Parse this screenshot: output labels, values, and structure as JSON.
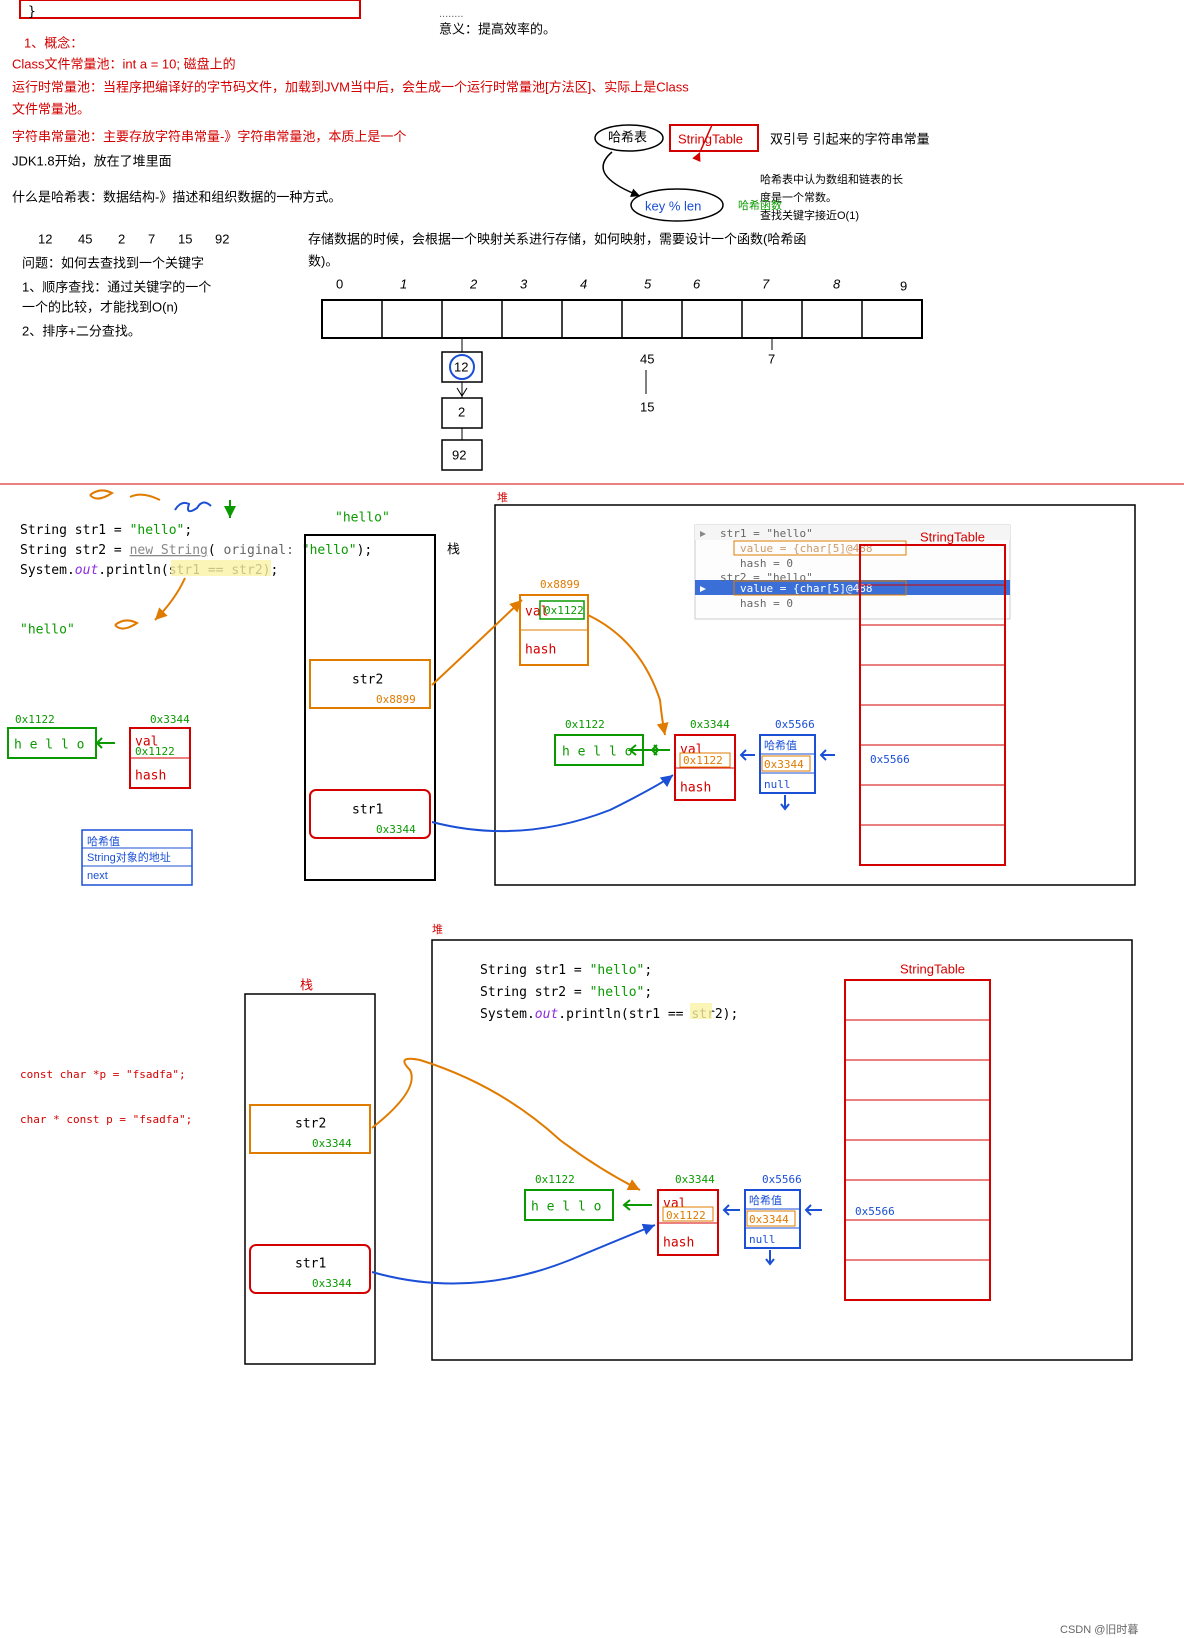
{
  "meaning": "意义：提高效率的。",
  "para1_title": "1、概念：",
  "para1_l1": "Class文件常量池：int a = 10;  磁盘上的",
  "para1_l2": "运行时常量池：当程序把编译好的字节码文件，加载到JVM当中后，会生成一个运行时常量池[方法区]、实际上是Class",
  "para1_l3": "文件常量池。",
  "para1_l4a": "字符串常量池：主要存放字符串常量-》字符串常量池，本质上是一个",
  "hashword": "哈希表",
  "stringtable": "StringTable",
  "para1_tail": "双引号 引起来的字符串常量",
  "jdk18": "JDK1.8开始，放在了堆里面",
  "hashdef": "什么是哈希表：数据结构-》描述和组织数据的一种方式。",
  "keylen": "key % len",
  "hashfn": "哈希函数",
  "hashSide1": "哈希表中认为数组和链表的长",
  "hashSide2": "度是一个常数。",
  "hashSide3": "查找关键字接近O(1)",
  "nums": [
    "12",
    "45",
    "2",
    "7",
    "15",
    "92"
  ],
  "question": "问题：如何去查找到一个关键字",
  "q1": "1、顺序查找：通过关键字的一个",
  "q1b": "  一个的比较，才能找到O(n)",
  "q2": "2、排序+二分查找。",
  "storeDesc1": "存储数据的时候，会根据一个映射关系进行存储，如何映射，需要设计一个函数(哈希函",
  "storeDesc2": "数)。",
  "idx": [
    "0",
    "1",
    "2",
    "3",
    "4",
    "5",
    "6",
    "7",
    "8",
    "9"
  ],
  "chain1": "12",
  "chain2": "2",
  "chain3": "92",
  "col5a": "45",
  "col5b": "15",
  "col7": "7",
  "code1_l1": "String str1 = ",
  "code1_s1": "\"hello\"",
  "code1_t1": ";",
  "code1_l2a": "String str2 = ",
  "code1_newstr": "new String",
  "code1_paren": "(",
  "code1_orig": " original: ",
  "code1_s2": "\"hello\"",
  "code1_l2b": ");",
  "code1_l3a": "System.",
  "code1_out": "out",
  "code1_l3b": ".println(str1 == str2);",
  "stack_lbl": "栈",
  "heap_lbl": "堆",
  "hello_green": "\"hello\"",
  "hello_plain": "\"hello\"",
  "addr1122": "0x1122",
  "addr3344": "0x3344",
  "addr8899": "0x8899",
  "addr5566": "0x5566",
  "val_l": "val",
  "hash_l": "hash",
  "hello_chars": "h e l l o",
  "legend_hash": "哈希值",
  "legend_addr": "String对象的地址",
  "legend_next": "next",
  "null_l": "null",
  "dbg_str1": "str1 = \"hello\"",
  "dbg_val1": "value = {char[5]@488",
  "dbg_hash1": "hash = 0",
  "dbg_str2": "str2 = \"hello\"",
  "dbg_val2": "value = {char[5]@488",
  "dbg_hash2": "hash = 0",
  "code2_l1": "String str1 = ",
  "code2_s1": "\"hello\"",
  "code2_t1": ";",
  "code2_l2": "String str2 = ",
  "code2_s2": "\"hello\"",
  "code2_t2": ";",
  "code2_l3a": "System.",
  "code2_out": "out",
  "code2_l3b": ".println(str1 ",
  "code2_eq": "==",
  "code2_l3c": " str2);",
  "const1": "const char *p  = \"fsadfa\";",
  "const2": "char * const  p  = \"fsadfa\";",
  "watermark": "CSDN @旧时暮"
}
